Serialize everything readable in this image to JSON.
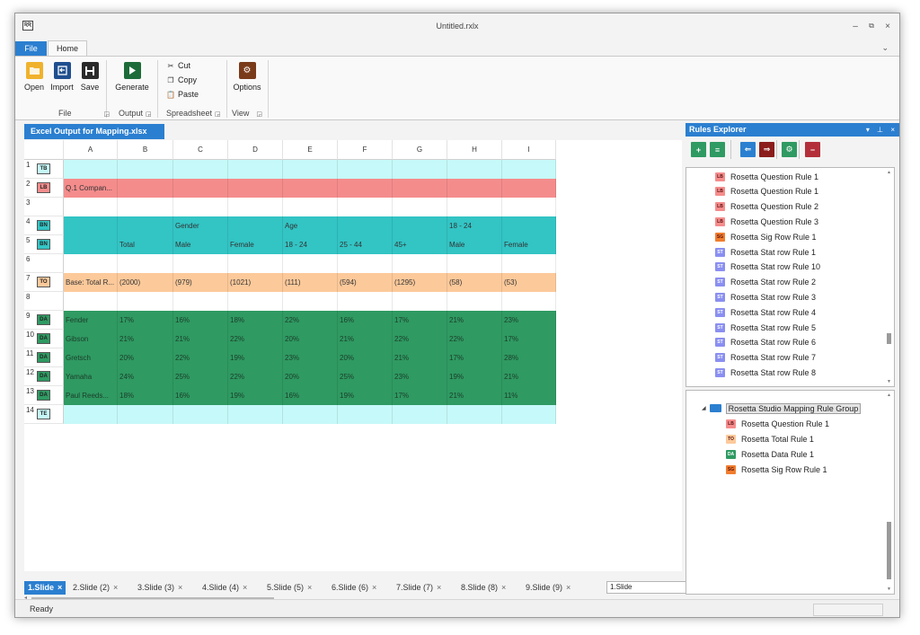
{
  "window": {
    "title": "Untitled.rxlx",
    "controls": {
      "minimize": "–",
      "restore": "⧉",
      "close": "×"
    },
    "app_icon": "rr-app-icon",
    "collapse_ribbon": "⌄"
  },
  "ribbon": {
    "tabs": {
      "file": "File",
      "home": "Home"
    },
    "buttons": [
      {
        "label": "Open",
        "icon": "folder-open-icon",
        "color": "#f0b22c"
      },
      {
        "label": "Import",
        "icon": "import-icon",
        "color": "#1f4f8f"
      },
      {
        "label": "Save",
        "icon": "save-icon",
        "color": "#2a2a2a"
      },
      {
        "label": "Generate",
        "icon": "play-icon",
        "color": "#1e6b3a"
      },
      {
        "label": "Options",
        "icon": "gear-icon",
        "color": "#7a3b1a"
      }
    ],
    "clipboard": {
      "cut": "Cut",
      "copy": "Copy",
      "paste": "Paste"
    },
    "groups": {
      "file": "File",
      "output": "Output",
      "spreadsheet": "Spreadsheet",
      "view": "View"
    }
  },
  "document_tab": "Excel Output for Mapping.xlsx",
  "grid": {
    "columns": [
      "A",
      "B",
      "C",
      "D",
      "E",
      "F",
      "G",
      "H",
      "I"
    ],
    "rows": [
      {
        "num": "1",
        "badge": "TB",
        "color": "#c6f9f9",
        "badge_color": "#c6f9f9",
        "cells": [
          "",
          "",
          "",
          "",
          "",
          "",
          "",
          "",
          ""
        ]
      },
      {
        "num": "2",
        "badge": "LB",
        "color": "#f58c8c",
        "badge_color": "#f58c8c",
        "cells": [
          "Q.1 Compan...",
          "",
          "",
          "",
          "",
          "",
          "",
          "",
          ""
        ]
      },
      {
        "num": "3",
        "badge": "",
        "color": "#ffffff",
        "badge_color": "",
        "cells": [
          "",
          "",
          "",
          "",
          "",
          "",
          "",
          "",
          ""
        ]
      },
      {
        "num": "4",
        "badge": "BN",
        "color": "#33c4c4",
        "badge_color": "#33c4c4",
        "cells": [
          "",
          "",
          "Gender",
          "",
          "Age",
          "",
          "",
          "18 - 24",
          ""
        ]
      },
      {
        "num": "5",
        "badge": "BN",
        "color": "#33c4c4",
        "badge_color": "#33c4c4",
        "cells": [
          "",
          "Total",
          "Male",
          "Female",
          "18 - 24",
          "25 - 44",
          "45+",
          "Male",
          "Female"
        ]
      },
      {
        "num": "6",
        "badge": "",
        "color": "#ffffff",
        "badge_color": "",
        "cells": [
          "",
          "",
          "",
          "",
          "",
          "",
          "",
          "",
          ""
        ]
      },
      {
        "num": "7",
        "badge": "TO",
        "color": "#fcc99a",
        "badge_color": "#fcc99a",
        "cells": [
          "Base: Total R...",
          "(2000)",
          "(979)",
          "(1021)",
          "(111)",
          "(594)",
          "(1295)",
          "(58)",
          "(53)"
        ]
      },
      {
        "num": "8",
        "badge": "",
        "color": "#ffffff",
        "badge_color": "",
        "cells": [
          "",
          "",
          "",
          "",
          "",
          "",
          "",
          "",
          ""
        ]
      },
      {
        "num": "9",
        "badge": "DA",
        "color": "#2f9a62",
        "badge_color": "#2f9a62",
        "cells": [
          "Fender",
          "17%",
          "16%",
          "18%",
          "22%",
          "16%",
          "17%",
          "21%",
          "23%"
        ]
      },
      {
        "num": "10",
        "badge": "DA",
        "color": "#2f9a62",
        "badge_color": "#2f9a62",
        "cells": [
          "Gibson",
          "21%",
          "21%",
          "22%",
          "20%",
          "21%",
          "22%",
          "22%",
          "17%"
        ]
      },
      {
        "num": "11",
        "badge": "DA",
        "color": "#2f9a62",
        "badge_color": "#2f9a62",
        "cells": [
          "Gretsch",
          "20%",
          "22%",
          "19%",
          "23%",
          "20%",
          "21%",
          "17%",
          "28%"
        ]
      },
      {
        "num": "12",
        "badge": "DA",
        "color": "#2f9a62",
        "badge_color": "#2f9a62",
        "cells": [
          "Yamaha",
          "24%",
          "25%",
          "22%",
          "20%",
          "25%",
          "23%",
          "19%",
          "21%"
        ]
      },
      {
        "num": "13",
        "badge": "DA",
        "color": "#2f9a62",
        "badge_color": "#2f9a62",
        "cells": [
          "Paul Reeds...",
          "18%",
          "16%",
          "19%",
          "16%",
          "19%",
          "17%",
          "21%",
          "11%"
        ]
      },
      {
        "num": "14",
        "badge": "TE",
        "color": "#c6f9f9",
        "badge_color": "#c6f9f9",
        "cells": [
          "",
          "",
          "",
          "",
          "",
          "",
          "",
          "",
          ""
        ]
      }
    ]
  },
  "sheet_tabs": [
    {
      "label": "1.Slide",
      "active": true
    },
    {
      "label": "2.Slide (2)",
      "active": false
    },
    {
      "label": "3.Slide (3)",
      "active": false
    },
    {
      "label": "4.Slide (4)",
      "active": false
    },
    {
      "label": "5.Slide (5)",
      "active": false
    },
    {
      "label": "6.Slide (6)",
      "active": false
    },
    {
      "label": "7.Slide (7)",
      "active": false
    },
    {
      "label": "8.Slide (8)",
      "active": false
    },
    {
      "label": "9.Slide (9)",
      "active": false
    }
  ],
  "sheet_close": "×",
  "slide_select": {
    "value": "1.Slide",
    "arrow": "▼"
  },
  "status": {
    "text": "Ready"
  },
  "rules_explorer": {
    "title": "Rules Explorer",
    "controls": "▾ ⊥ ×",
    "toolbar": [
      {
        "icon": "add-rule-icon",
        "color": "#2f9a62",
        "glyph": "+"
      },
      {
        "icon": "add-rule-group-icon",
        "color": "#2f9a62",
        "glyph": "≡"
      },
      {
        "icon": "import-rules-icon",
        "color": "#2b7fd0",
        "glyph": "⇐"
      },
      {
        "icon": "export-rules-icon",
        "color": "#8b1c1c",
        "glyph": "⇒"
      },
      {
        "icon": "rule-settings-icon",
        "color": "#2f9a62",
        "glyph": "⚙"
      },
      {
        "icon": "remove-rule-icon",
        "color": "#b3303b",
        "glyph": "−"
      }
    ],
    "rules": [
      {
        "badge": "LB",
        "color": "#f58c8c",
        "label": "Rosetta Question Rule 1"
      },
      {
        "badge": "LB",
        "color": "#f58c8c",
        "label": "Rosetta Question Rule 1"
      },
      {
        "badge": "LB",
        "color": "#f58c8c",
        "label": "Rosetta Question Rule 2"
      },
      {
        "badge": "LB",
        "color": "#f58c8c",
        "label": "Rosetta Question Rule 3"
      },
      {
        "badge": "SG",
        "color": "#f07d2e",
        "label": "Rosetta Sig Row Rule 1"
      },
      {
        "badge": "ST",
        "color": "#8a8ff0",
        "label": "Rosetta Stat row Rule 1"
      },
      {
        "badge": "ST",
        "color": "#8a8ff0",
        "label": "Rosetta Stat row Rule 10"
      },
      {
        "badge": "ST",
        "color": "#8a8ff0",
        "label": "Rosetta Stat row Rule 2"
      },
      {
        "badge": "ST",
        "color": "#8a8ff0",
        "label": "Rosetta Stat row Rule 3"
      },
      {
        "badge": "ST",
        "color": "#8a8ff0",
        "label": "Rosetta Stat row Rule 4"
      },
      {
        "badge": "ST",
        "color": "#8a8ff0",
        "label": "Rosetta Stat row Rule 5"
      },
      {
        "badge": "ST",
        "color": "#8a8ff0",
        "label": "Rosetta Stat row Rule 6"
      },
      {
        "badge": "ST",
        "color": "#8a8ff0",
        "label": "Rosetta Stat row Rule 7"
      },
      {
        "badge": "ST",
        "color": "#8a8ff0",
        "label": "Rosetta Stat row Rule 8"
      }
    ],
    "group": {
      "label": "Rosetta Studio Mapping Rule Group",
      "children": [
        {
          "badge": "LB",
          "color": "#f58c8c",
          "label": "Rosetta Question Rule 1"
        },
        {
          "badge": "TO",
          "color": "#fcc99a",
          "label": "Rosetta Total Rule 1"
        },
        {
          "badge": "DA",
          "color": "#2f9a62",
          "label": "Rosetta Data Rule 1"
        },
        {
          "badge": "SG",
          "color": "#f07d2e",
          "label": "Rosetta Sig Row Rule 1"
        }
      ]
    }
  }
}
